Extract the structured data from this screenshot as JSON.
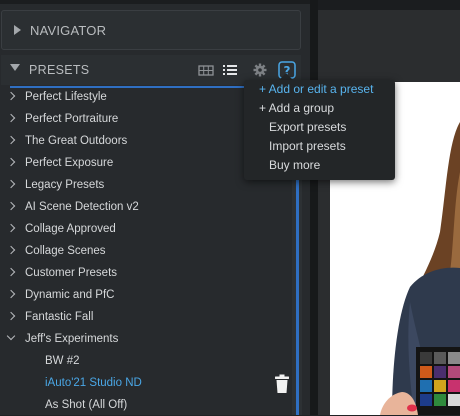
{
  "navigator": {
    "title": "NAVIGATOR"
  },
  "presets": {
    "title": "PRESETS",
    "header_icons": [
      "grid-view-icon",
      "list-view-icon",
      "gear-icon",
      "help-icon"
    ],
    "help_glyph": "?",
    "groups": [
      {
        "label": "Perfect Lifestyle"
      },
      {
        "label": "Perfect Portraiture"
      },
      {
        "label": "The Great Outdoors"
      },
      {
        "label": "Perfect Exposure"
      },
      {
        "label": "Legacy Presets"
      },
      {
        "label": "AI Scene Detection v2"
      },
      {
        "label": "Collage Approved"
      },
      {
        "label": "Collage Scenes"
      },
      {
        "label": "Customer Presets"
      },
      {
        "label": "Dynamic and PfC"
      },
      {
        "label": "Fantastic Fall"
      },
      {
        "label": "Jeff's Experiments",
        "expanded": true
      }
    ],
    "children": [
      {
        "label": "BW #2"
      },
      {
        "label": "iAuto'21 Studio ND",
        "selected": true
      },
      {
        "label": "As Shot (All Off)"
      }
    ]
  },
  "menu": {
    "items": [
      {
        "label": "+ Add or edit a preset",
        "active": true
      },
      {
        "label": "+ Add a group"
      },
      {
        "label": "Export presets"
      },
      {
        "label": "Import presets"
      },
      {
        "label": "Buy more"
      }
    ]
  },
  "colors": {
    "accent_blue": "#2f6fc2",
    "selected_text": "#4aa7e6",
    "panel_bg": "#272a2d"
  }
}
